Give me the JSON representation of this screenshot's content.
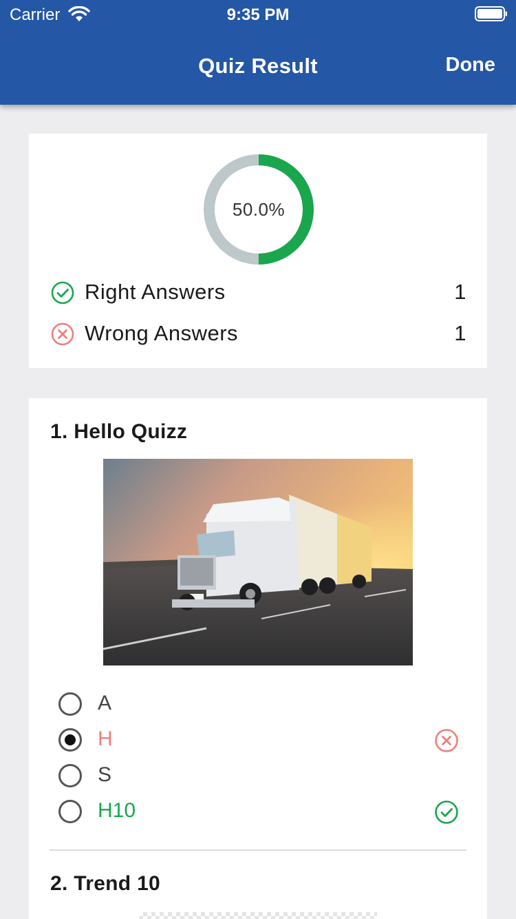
{
  "status_bar": {
    "carrier": "Carrier",
    "time": "9:35 PM"
  },
  "nav": {
    "title": "Quiz Result",
    "done_label": "Done"
  },
  "summary": {
    "percent_label": "50.0%",
    "percent_value": 0.5,
    "colors": {
      "progress": "#1aa64d",
      "track": "#bcc8ca"
    },
    "right_label": "Right Answers",
    "right_count": "1",
    "wrong_label": "Wrong Answers",
    "wrong_count": "1"
  },
  "questions": [
    {
      "title": "1. Hello Quizz",
      "image": "truck-photo",
      "options": [
        {
          "label": "A",
          "selected": false,
          "status": "none"
        },
        {
          "label": "H",
          "selected": true,
          "status": "wrong"
        },
        {
          "label": "S",
          "selected": false,
          "status": "none"
        },
        {
          "label": "H10",
          "selected": false,
          "status": "correct"
        }
      ]
    },
    {
      "title": "2. Trend 10",
      "image": "image-loading-placeholder"
    }
  ],
  "colors": {
    "header": "#2457a6",
    "correct": "#1aa64d",
    "wrong": "#ee7f7c",
    "background": "#ededef"
  },
  "icons": {
    "right": "check-circle-icon",
    "wrong": "x-circle-icon",
    "wifi": "wifi-icon",
    "battery": "battery-icon"
  }
}
